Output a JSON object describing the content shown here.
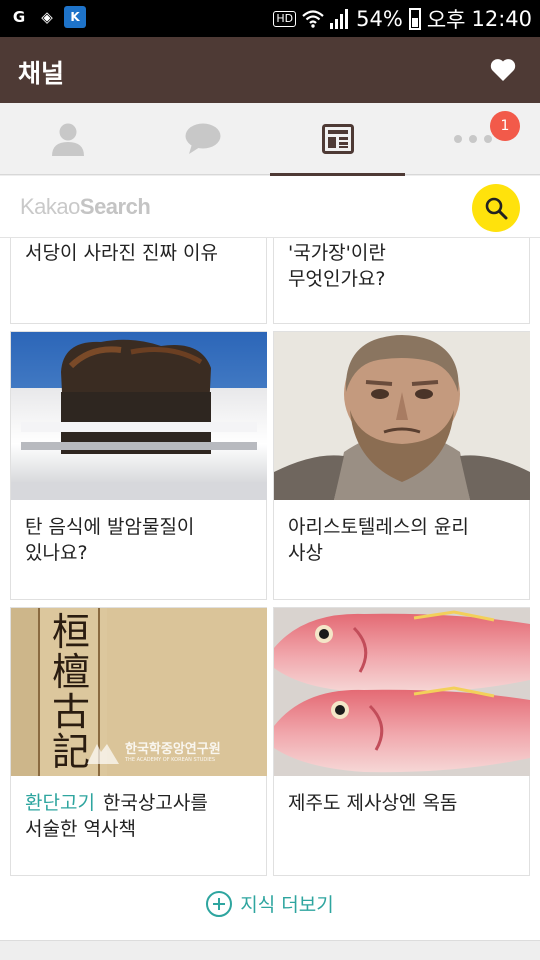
{
  "status_bar": {
    "app_icons": [
      "G",
      "K"
    ],
    "hd_label": "HD",
    "battery": "54%",
    "ampm": "오후",
    "time": "12:40"
  },
  "header": {
    "title": "채널"
  },
  "tabs": [
    {
      "icon": "friends-icon"
    },
    {
      "icon": "chat-icon"
    },
    {
      "icon": "channel-icon",
      "active": true
    },
    {
      "icon": "more-icon",
      "badge": "1"
    }
  ],
  "search": {
    "brand_light": "Kakao",
    "brand_bold": "Search"
  },
  "cards": [
    {
      "title": "서당이 사라진 진짜 이유"
    },
    {
      "title": "'국가장'이란\n무엇인가요?"
    },
    {
      "title": "탄 음식에 발암물질이\n있나요?"
    },
    {
      "title": "아리스토텔레스의 윤리\n사상"
    },
    {
      "tag": "환단고기",
      "title": "한국상고사를",
      "title_line2": "서술한 역사책"
    },
    {
      "title": "제주도 제사상엔 옥돔"
    }
  ],
  "book_image": {
    "characters": [
      "桓",
      "檀",
      "古",
      "記"
    ],
    "watermark": "한국학중앙연구원",
    "watermark_en": "THE ACADEMY OF KOREAN STUDIES"
  },
  "more_button": {
    "label": "지식 더보기"
  },
  "colors": {
    "header": "#4e3a35",
    "accent": "#2ea59f",
    "search": "#ffe20c",
    "badge": "#f25a4a"
  }
}
